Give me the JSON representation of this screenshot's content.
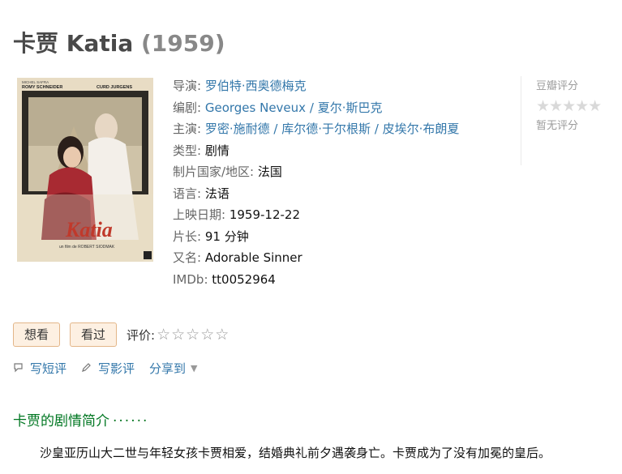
{
  "title": {
    "name": "卡贾 Katia",
    "year": "(1959)"
  },
  "poster": {
    "credits_top": "MICHEL SAFRA",
    "star1": "ROMY SCHNEIDER",
    "star2": "CURD JURGENS",
    "movie_title": "Katia",
    "director_line": "un film de ROBERT SIODMAK"
  },
  "info": {
    "director_label": "导演:",
    "director": "罗伯特·西奥德梅克",
    "writer_label": "编剧:",
    "writers": [
      "Georges Neveux",
      "夏尔·斯巴克"
    ],
    "cast_label": "主演:",
    "cast": [
      "罗密·施耐德",
      "库尔德·于尔根斯",
      "皮埃尔·布朗夏"
    ],
    "genre_label": "类型:",
    "genre": "剧情",
    "country_label": "制片国家/地区:",
    "country": "法国",
    "language_label": "语言:",
    "language": "法语",
    "release_label": "上映日期:",
    "release": "1959-12-22",
    "runtime_label": "片长:",
    "runtime": "91 分钟",
    "aka_label": "又名:",
    "aka": "Adorable Sinner",
    "imdb_label": "IMDb:",
    "imdb": "tt0052964",
    "separator": "/"
  },
  "rating": {
    "label": "豆瓣评分",
    "stars": "★★★★★",
    "none_text": "暂无评分"
  },
  "actions": {
    "want_label": "想看",
    "seen_label": "看过",
    "rate_label": "评价:",
    "rate_stars": "☆☆☆☆☆"
  },
  "links": {
    "short_review": "写短评",
    "review": "写影评",
    "share": "分享到",
    "caret": "▼"
  },
  "summary": {
    "heading": "卡贾的剧情简介",
    "dots": "······",
    "text": "沙皇亚历山大二世与年轻女孩卡贾相爱，结婚典礼前夕遇袭身亡。卡贾成为了没有加冕的皇后。"
  },
  "colors": {
    "link": "#3377aa",
    "heading_green": "#007722",
    "button_bg": "#fdf0e2"
  }
}
